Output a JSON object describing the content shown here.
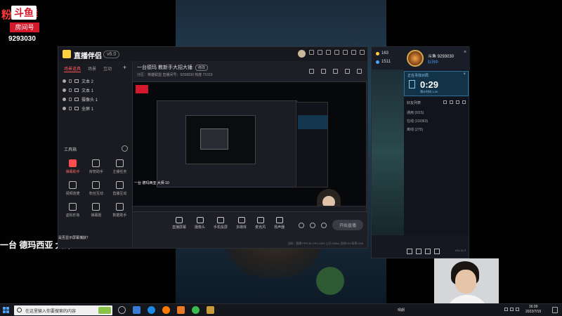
{
  "overlay": {
    "banner_text": "粉 进群",
    "logo_text": "斗鱼",
    "room_label": "房间号",
    "room_number": "9293030"
  },
  "stream_caption": "一台 德玛西亚 大师 10",
  "app": {
    "name": "直播伴侣",
    "version_badge": "v6.0",
    "sidebar_tabs": [
      "场景道具",
      "场景",
      "互动"
    ],
    "add_label": "+",
    "layers": [
      "文本 2",
      "文本 1",
      "摄像头 1",
      "全屏 1"
    ],
    "toolbox_title": "工具箱",
    "tools": [
      {
        "label": "弹幕助手",
        "active": true
      },
      {
        "label": "房管助手",
        "active": false
      },
      {
        "label": "主播任务",
        "active": false
      },
      {
        "label": "视频连麦",
        "active": false
      },
      {
        "label": "粉丝互动",
        "active": false
      },
      {
        "label": "直播互动",
        "active": false
      },
      {
        "label": "虚拟形象",
        "active": false
      },
      {
        "label": "弹幕姬",
        "active": false
      },
      {
        "label": "数据助手",
        "active": false
      }
    ],
    "room_title": "一台德玛 教新手大招大锤",
    "room_title_chip": "修改",
    "room_meta": "分区：英雄联盟    直播间号：9293030    热度 71019",
    "bottom_tools": [
      "直播屏幕",
      "摄像头",
      "手机投屏",
      "多媒体",
      "麦克风",
      "扬声器"
    ],
    "start_button": "开始直播",
    "status_text": "当前：直播  FPS:30  CPU:18%  上行:0KB/s  丢帧:0%  码率:0KB",
    "tooltip": "是否显示屏幕捕获？"
  },
  "preview": {
    "caption": "一台 德玛西亚 大师 10"
  },
  "client": {
    "level_value": "163",
    "points_value": "1511",
    "player_name": "斗鱼 9293030",
    "player_status": "队列中",
    "queue_label": "正在寻找对局",
    "queue_time": "0:29",
    "queue_estimate": "预计时间 1:20",
    "friends_header": "好友列表",
    "groups": [
      "通用 (0/15)",
      "在线 (10/363)",
      "离线 (270)"
    ],
    "version_text": "V11.11.3",
    "close_label": "×"
  },
  "taskbar": {
    "search_placeholder": "在这里输入你要搜索的内容",
    "tray_text": "晴朗",
    "time": "16:39",
    "date": "2022/7/15"
  },
  "colors": {
    "brand_red": "#d3192b",
    "accent_blue": "#4aa3ff",
    "queue_bg": "#123247"
  }
}
